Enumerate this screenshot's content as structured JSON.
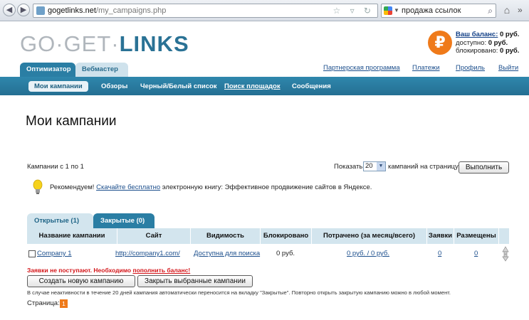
{
  "browser": {
    "url_host": "gogetlinks.net",
    "url_path": "/my_campaigns.php",
    "search_text": "продажа ссылок"
  },
  "logo": {
    "part1": "GO",
    "part2": "GET",
    "part3": "LINKS"
  },
  "balance": {
    "currency_symbol": "₽",
    "label_balance": "Ваш баланс:",
    "value_balance": "0 руб.",
    "label_available": "доступно:",
    "value_available": "0 руб.",
    "label_blocked": "блокировано:",
    "value_blocked": "0 руб."
  },
  "role_tabs": {
    "optimizer": "Оптимизатор",
    "webmaster": "Вебмастер"
  },
  "top_links": {
    "partner": "Партнерская программа",
    "payments": "Платежи",
    "profile": "Профиль",
    "logout": "Выйти"
  },
  "nav": {
    "my_campaigns": "Мои кампании",
    "reviews": "Обзоры",
    "blackwhite": "Черный/Белый список",
    "site_search": "Поиск площадок",
    "messages": "Сообщения"
  },
  "page_title": "Мои кампании",
  "campaign_count": "Кампании с 1 по 1",
  "per_page": {
    "show_label": "Показать",
    "value": "20",
    "after_label": "кампаний на страницу",
    "submit": "Выполнить"
  },
  "tip": {
    "prefix": "Рекомендуем!",
    "link": "Скачайте бесплатно",
    "suffix": "электронную книгу: Эффективное продвижение сайтов в Яндексе."
  },
  "list_tabs": {
    "open": "Открытые (1)",
    "closed": "Закрытые (0)"
  },
  "table": {
    "headers": [
      "Название кампании",
      "Сайт",
      "Видимость",
      "Блокировано",
      "Потрачено (за месяц/всего)",
      "Заявки",
      "Размещены"
    ],
    "rows": [
      {
        "name": "Company 1",
        "site": "http://company1.com/",
        "visibility": "Доступна для поиска",
        "blocked": "0 руб.",
        "spent": "0 руб. / 0 руб.",
        "requests": "0",
        "placed": "0"
      }
    ]
  },
  "warning": {
    "text": "Заявки не поступают. Необходимо",
    "link": "пополнить баланс!"
  },
  "buttons": {
    "create": "Создать новую кампанию",
    "close_selected": "Закрыть выбранные кампании"
  },
  "note": "В случае неактивности в течение 20 дней кампания автоматически переносится на вкладку \"Закрытые\". Повторно открыть закрытую кампанию можно в любой момент.",
  "pager": {
    "label": "Страница:",
    "current": "1"
  }
}
